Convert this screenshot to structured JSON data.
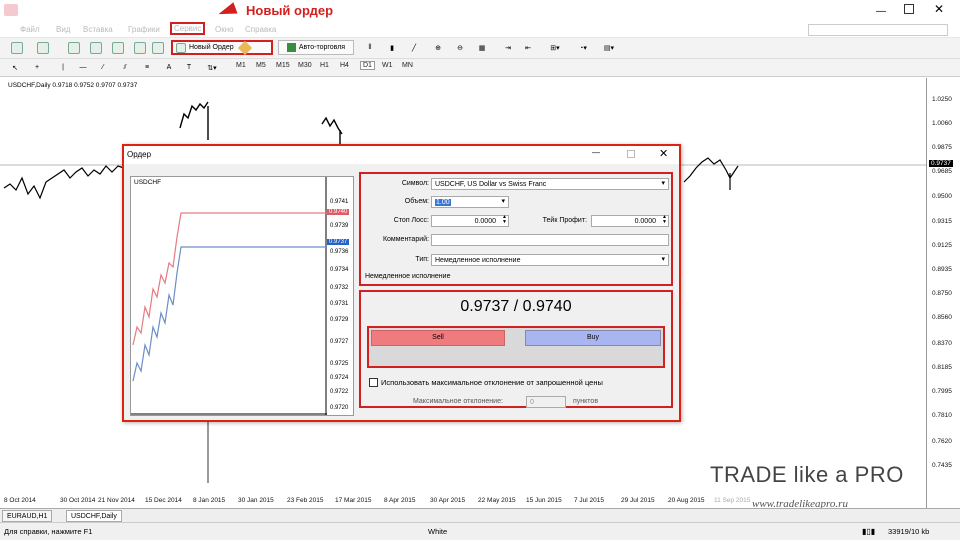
{
  "annotation": {
    "label": "Новый ордер",
    "color": "#d21f1f"
  },
  "menu": [
    "Файл",
    "Вид",
    "Вставка",
    "Графики",
    "Сервис",
    "Окно",
    "Справка"
  ],
  "toolbar": {
    "new_order": "Новый Ордер",
    "auto_trading": "Авто-торговля"
  },
  "timeframes": [
    "M1",
    "M5",
    "M15",
    "M30",
    "H1",
    "H4",
    "D1",
    "W1",
    "MN"
  ],
  "chart": {
    "info": "USDCHF,Daily  0.9718 0.9752 0.9707 0.9737",
    "current_price": "0.9737",
    "price_ticks": [
      "1.0250",
      "1.0060",
      "0.9875",
      "0.9737",
      "0.9685",
      "0.9500",
      "0.9315",
      "0.9125",
      "0.8935",
      "0.8750",
      "0.8560",
      "0.8370",
      "0.8185",
      "0.7995",
      "0.7810",
      "0.7620",
      "0.7435"
    ],
    "date_ticks": [
      "8 Oct 2014",
      "30 Oct 2014",
      "21 Nov 2014",
      "15 Dec 2014",
      "8 Jan 2015",
      "30 Jan 2015",
      "23 Feb 2015",
      "17 Mar 2015",
      "8 Apr 2015",
      "30 Apr 2015",
      "22 May 2015",
      "15 Jun 2015",
      "7 Jul 2015",
      "29 Jul 2015",
      "20 Aug 2015",
      "11 Sep 2015"
    ]
  },
  "tabs": [
    "EURAUD,H1",
    "USDCHF,Daily"
  ],
  "status": {
    "help": "Для справки, нажмите F1",
    "profile": "White",
    "traffic": "33919/10 kb"
  },
  "watermark": {
    "brand": "TRADE like a PRO",
    "url": "www.tradelikeapro.ru"
  },
  "dialog": {
    "title": "Ордер",
    "mini_chart": {
      "symbol": "USDCHF",
      "ticks": [
        "0.9741",
        "0.9740",
        "0.9739",
        "0.9737",
        "0.9736",
        "0.9734",
        "0.9732",
        "0.9731",
        "0.9729",
        "0.9727",
        "0.9725",
        "0.9724",
        "0.9722",
        "0.9720"
      ],
      "ask_label": "0.9740",
      "bid_label": "0.9737"
    },
    "symbol_label": "Символ:",
    "symbol_value": "USDCHF, US Dollar vs Swiss Franc",
    "volume_label": "Объем:",
    "volume_value": "1.00",
    "sl_label": "Стоп Лосс:",
    "sl_value": "0.0000",
    "tp_label": "Тейк Профит:",
    "tp_value": "0.0000",
    "comment_label": "Комментарий:",
    "type_label": "Тип:",
    "type_value": "Немедленное исполнение",
    "section_caption": "Немедленное исполнение",
    "quote": "0.9737 / 0.9740",
    "sell": "Sell",
    "buy": "Buy",
    "deviation_checkbox": "Использовать максимальное отклонение от запрошенной цены",
    "deviation_label": "Максимальное отклонение:",
    "deviation_value": "0",
    "deviation_unit": "пунктов"
  }
}
